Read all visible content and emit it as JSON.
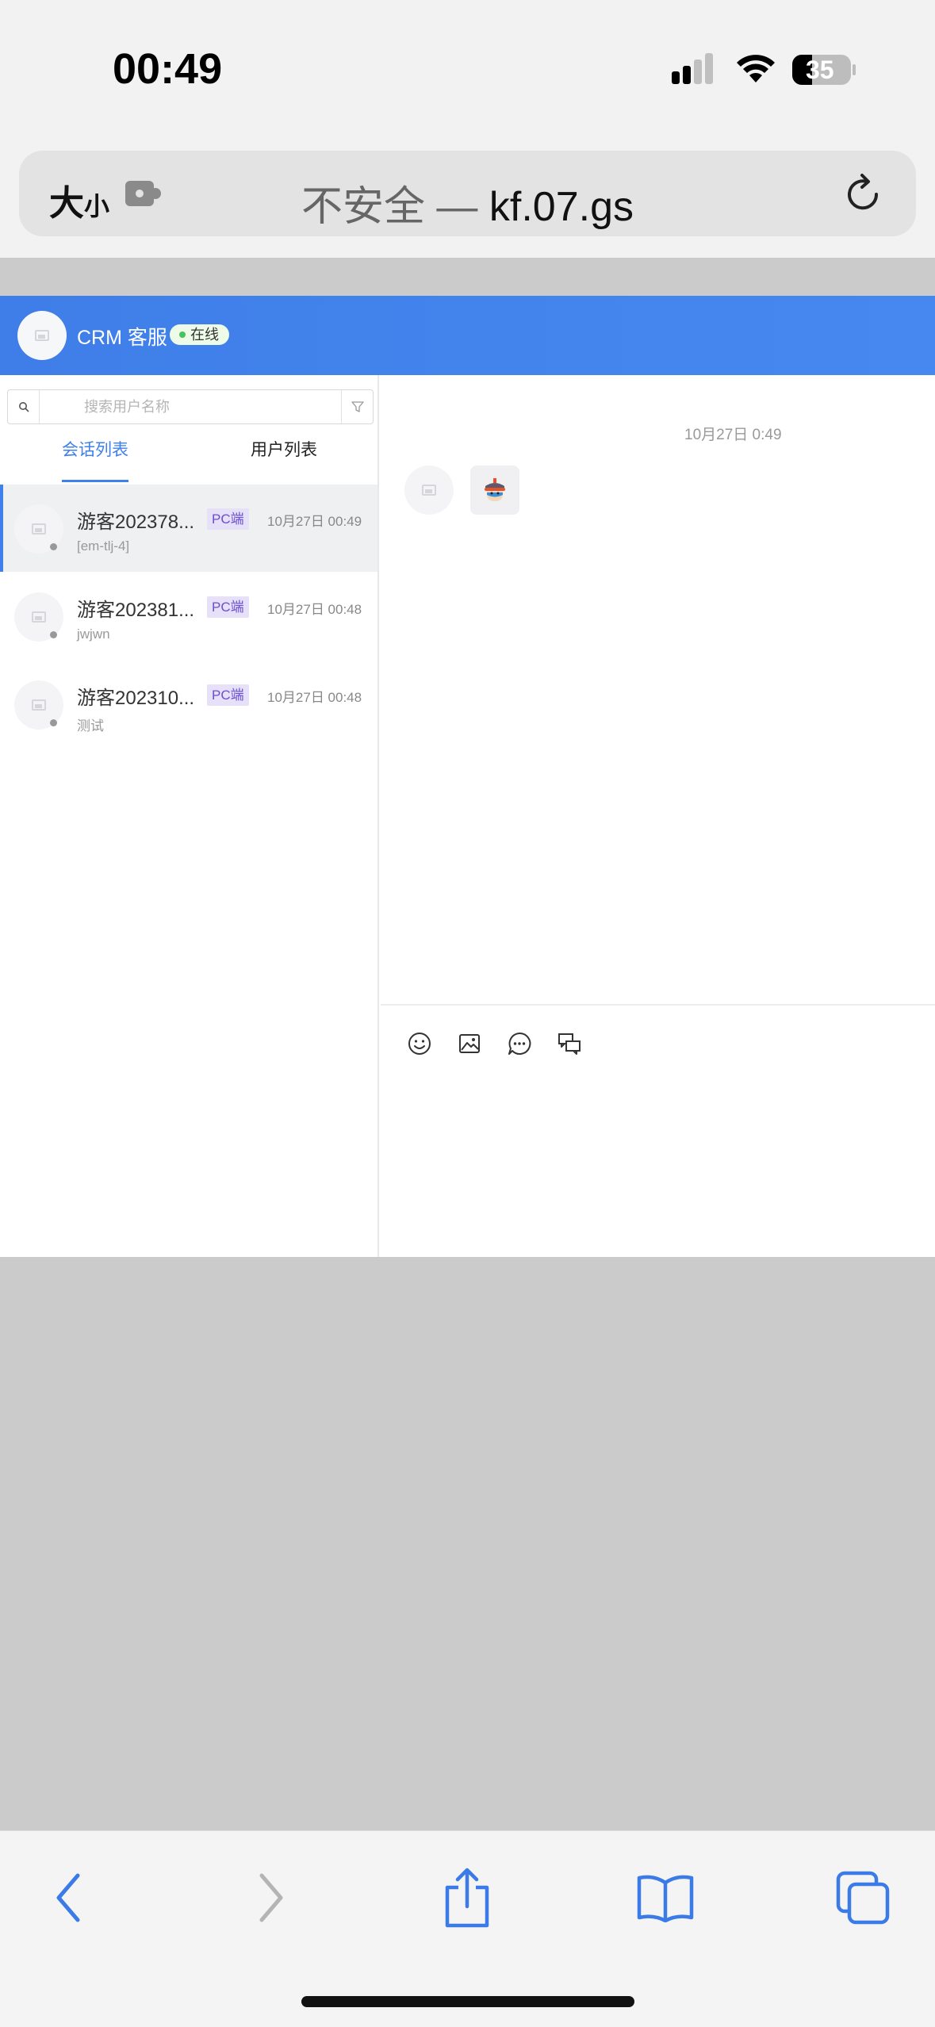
{
  "status_bar": {
    "time": "00:49",
    "battery": "35"
  },
  "browser": {
    "text_size_big": "大",
    "text_size_small": "小",
    "url_prefix": "不安全 — ",
    "url_domain": "kf.07.gs"
  },
  "header": {
    "title": "CRM 客服",
    "status": "在线"
  },
  "search": {
    "placeholder": "搜索用户名称"
  },
  "tabs": [
    {
      "label": "会话列表"
    },
    {
      "label": "用户列表"
    }
  ],
  "conversations": [
    {
      "name": "游客202378...",
      "badge": "PC端",
      "time": "10月27日 00:49",
      "preview": "[em-tlj-4]"
    },
    {
      "name": "游客202381...",
      "badge": "PC端",
      "time": "10月27日 00:48",
      "preview": "jwjwn"
    },
    {
      "name": "游客202310...",
      "badge": "PC端",
      "time": "10月27日 00:48",
      "preview": "测试"
    }
  ],
  "chat": {
    "timestamp": "10月27日 0:49"
  },
  "colors": {
    "accent": "#3f80ea",
    "online": "#46c35a",
    "badge_bg": "#e6e0f8",
    "badge_text": "#6b4fd0"
  },
  "icons": {
    "toolbar": [
      "emoji-icon",
      "image-icon",
      "quick-reply-icon",
      "transfer-icon"
    ],
    "safari": [
      "back-icon",
      "forward-icon",
      "share-icon",
      "bookmarks-icon",
      "tabs-icon"
    ]
  }
}
